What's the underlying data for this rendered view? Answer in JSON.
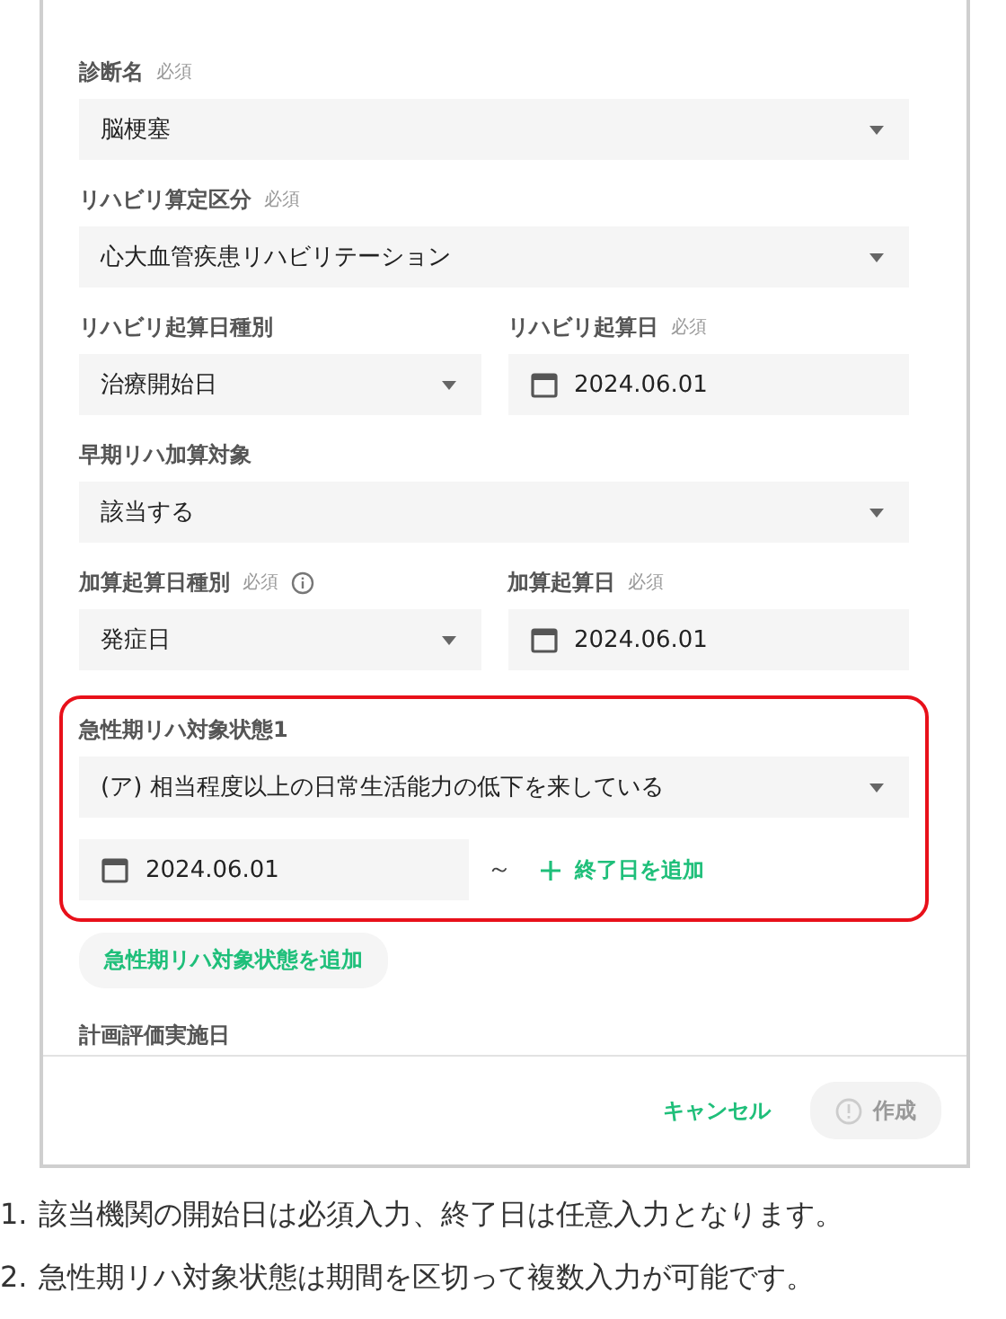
{
  "form": {
    "rows": [
      {
        "fields": [
          {
            "kind": "select",
            "label": "診断名",
            "required": "必須",
            "value": "脳梗塞"
          }
        ]
      },
      {
        "fields": [
          {
            "kind": "select",
            "label": "リハビリ算定区分",
            "required": "必須",
            "value": "心大血管疾患リハビリテーション"
          }
        ]
      },
      {
        "fields": [
          {
            "kind": "select",
            "label": "リハビリ起算日種別",
            "value": "治療開始日"
          },
          {
            "kind": "date",
            "label": "リハビリ起算日",
            "required": "必須",
            "value": "2024.06.01"
          }
        ]
      },
      {
        "fields": [
          {
            "kind": "select",
            "label": "早期リハ加算対象",
            "value": "該当する"
          }
        ]
      },
      {
        "fields": [
          {
            "kind": "select",
            "label": "加算起算日種別",
            "required": "必須",
            "info": true,
            "value": "発症日"
          },
          {
            "kind": "date",
            "label": "加算起算日",
            "required": "必須",
            "value": "2024.06.01"
          }
        ]
      }
    ],
    "acute_states": [
      {
        "highlighted": true,
        "label": "急性期リハ対象状態1",
        "value": "(ア) 相当程度以上の日常生活能力の低下を来している",
        "start_date": "2024.06.01",
        "range_mark": "～",
        "add_end": "終了日を追加"
      }
    ],
    "add_state_button": "急性期リハ対象状態を追加",
    "next_label": "計画評価実施日",
    "footer": {
      "cancel": "キャンセル",
      "create": {
        "label": "作成",
        "disabled": true
      }
    }
  },
  "notes": [
    {
      "number": "1.",
      "text": "該当機関の開始日は必須入力、終了日は任意入力となります。"
    },
    {
      "number": "2.",
      "text": "急性期リハ対象状態は期間を区切って複数入力が可能です。"
    }
  ]
}
